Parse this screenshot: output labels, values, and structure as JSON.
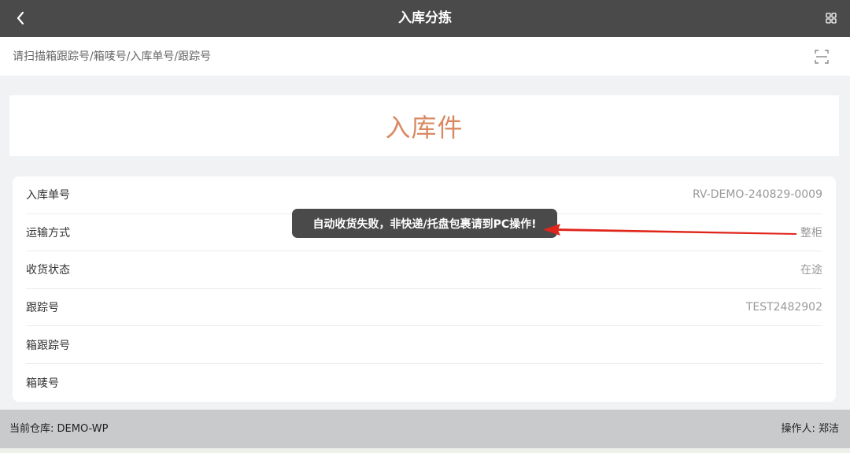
{
  "header": {
    "title": "入库分拣",
    "back_icon": "chevron-left-icon",
    "menu_icon": "grid-icon"
  },
  "scan": {
    "placeholder": "请扫描箱跟踪号/箱唛号/入库单号/跟踪号",
    "scan_icon": "scan-icon"
  },
  "type_card": {
    "label": "入库件",
    "color": "#d98a63"
  },
  "info": {
    "rows": [
      {
        "label": "入库单号",
        "value": "RV-DEMO-240829-0009"
      },
      {
        "label": "运输方式",
        "value": "整柜"
      },
      {
        "label": "收货状态",
        "value": "在途"
      },
      {
        "label": "跟踪号",
        "value": "TEST2482902"
      },
      {
        "label": "箱跟踪号",
        "value": ""
      },
      {
        "label": "箱唛号",
        "value": ""
      }
    ]
  },
  "toast": {
    "message": "自动收货失败，非快递/托盘包裹请到PC操作!"
  },
  "annotation": {
    "arrow_color": "#e0251b"
  },
  "footer": {
    "warehouse": "当前仓库: DEMO-WP",
    "operator": "操作人: 郑洁"
  }
}
